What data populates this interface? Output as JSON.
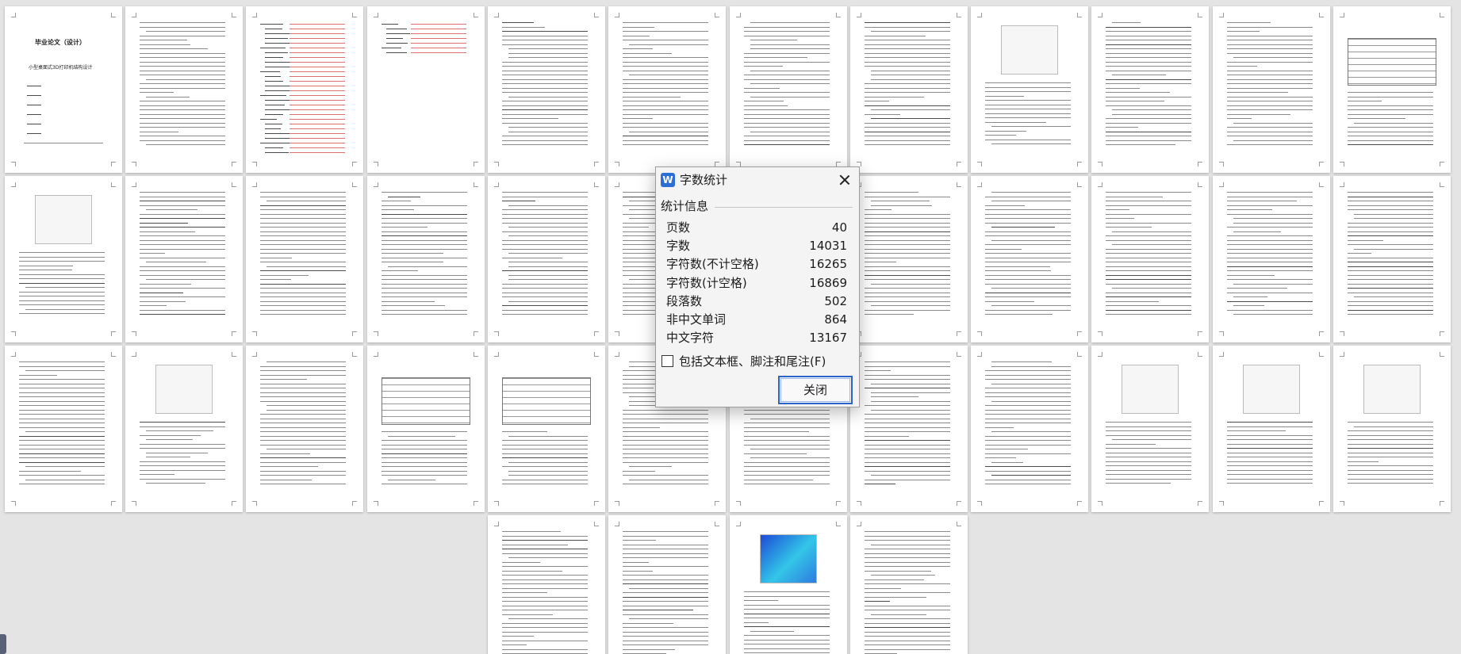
{
  "dialog": {
    "title": "字数统计",
    "section_label": "统计信息",
    "stats": [
      {
        "label": "页数",
        "value": "40"
      },
      {
        "label": "字数",
        "value": "14031"
      },
      {
        "label": "字符数(不计空格)",
        "value": "16265"
      },
      {
        "label": "字符数(计空格)",
        "value": "16869"
      },
      {
        "label": "段落数",
        "value": "502"
      },
      {
        "label": "非中文单词",
        "value": "864"
      },
      {
        "label": "中文字符",
        "value": "13167"
      }
    ],
    "checkbox_label": "包括文本框、脚注和尾注(F)",
    "checkbox_checked": false,
    "close_label": "关闭",
    "app_icon_glyph": "W"
  },
  "document": {
    "page_count": 40,
    "cover_title": "毕业论文（设计）",
    "cover_subtitle": "小型桌面式3D打印机结构设计",
    "abstract_heading": "摘  要",
    "abstract_en_heading": "Abstract",
    "toc_heading": "目  录"
  },
  "colors": {
    "background": "#e4e4e4",
    "page": "#ffffff",
    "accent": "#2a64c9",
    "app_icon": "#2b6fd6"
  }
}
